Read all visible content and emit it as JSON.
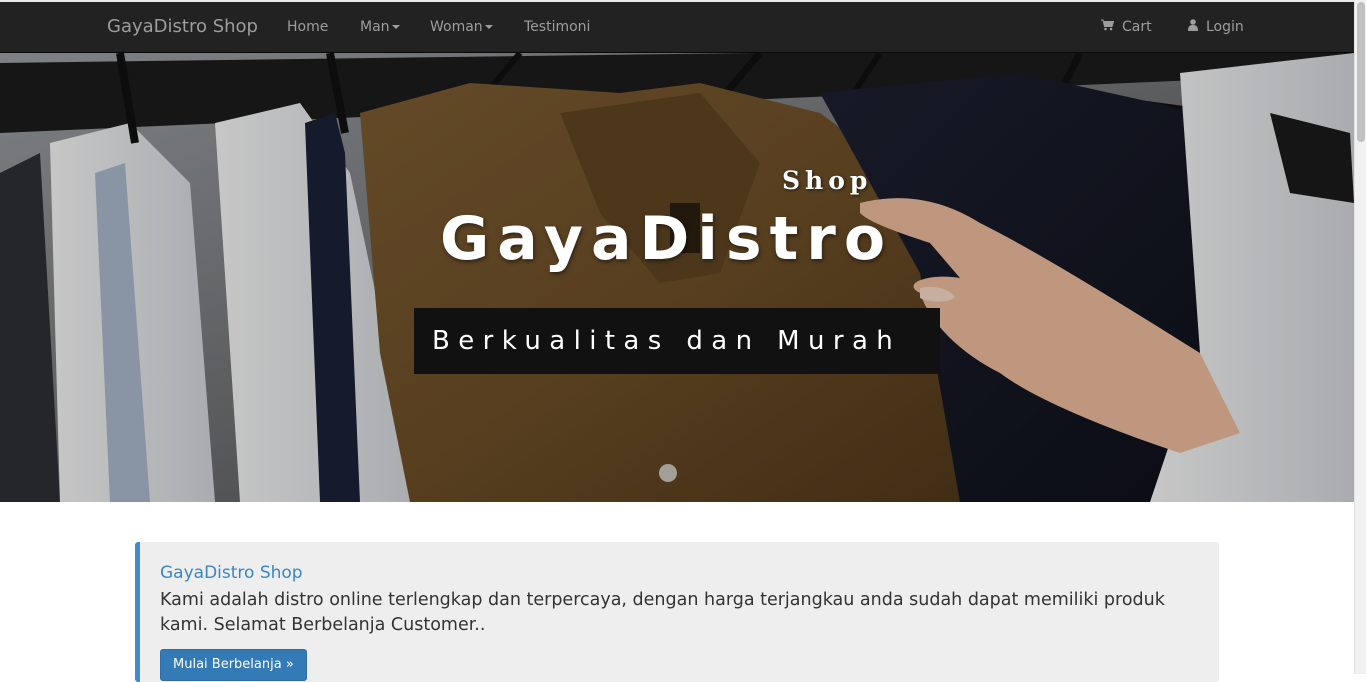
{
  "navbar": {
    "brand": "GayaDistro Shop",
    "items": [
      {
        "label": "Home",
        "dropdown": false
      },
      {
        "label": "Man",
        "dropdown": true
      },
      {
        "label": "Woman",
        "dropdown": true
      },
      {
        "label": "Testimoni",
        "dropdown": false
      }
    ],
    "right_items": [
      {
        "label": "Cart",
        "icon": "shopping-cart-icon"
      },
      {
        "label": "Login",
        "icon": "user-icon"
      }
    ]
  },
  "hero": {
    "subtitle": "Shop",
    "title": "GayaDistro",
    "tagline": "Berkualitas dan Murah"
  },
  "callout": {
    "title": "GayaDistro Shop",
    "text": "Kami adalah distro online terlengkap dan terpercaya, dengan harga terjangkau anda sudah dapat memiliki produk kami. Selamat Berbelanja Customer..",
    "button": "Mulai Berbelanja »"
  },
  "colors": {
    "navbar_bg": "#222222",
    "navbar_text": "#9d9d9d",
    "accent": "#428bca",
    "button_bg": "#337ab7",
    "callout_bg": "#eeeeee"
  }
}
